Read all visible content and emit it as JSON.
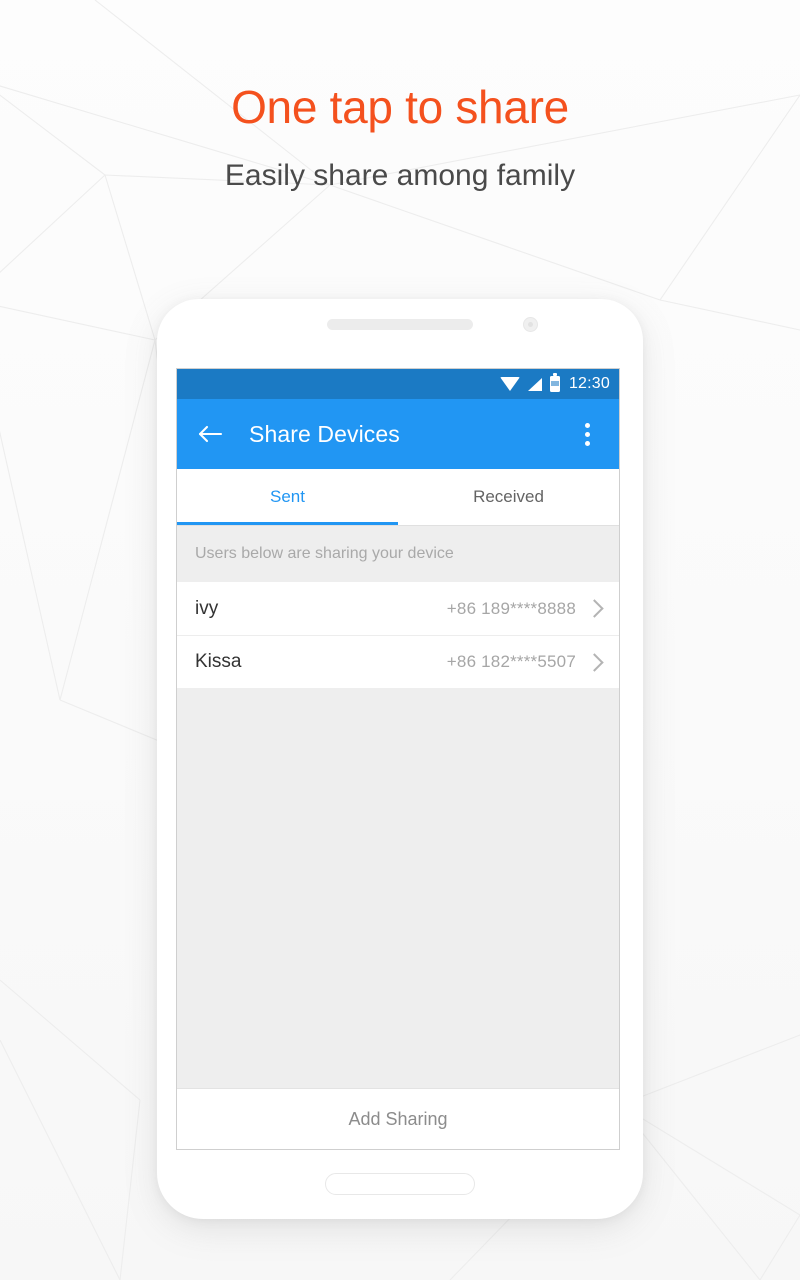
{
  "promo": {
    "headline": "One tap to share",
    "subheadline": "Easily share among family",
    "headline_color": "#f4511e",
    "subheadline_color": "#4a4a4a",
    "background_color": "#fbfbfb"
  },
  "device": {
    "frame_color": "#ffffff",
    "speaker_label": "earpiece-speaker",
    "camera_label": "front-camera",
    "home_button_label": "home-button"
  },
  "screen": {
    "status_bar": {
      "time": "12:30",
      "background_color": "#1b7ac4",
      "icons": [
        "wifi-icon",
        "signal-icon",
        "battery-icon"
      ]
    },
    "app_bar": {
      "title": "Share Devices",
      "background_color": "#2196f3",
      "back_label": "Back",
      "overflow_label": "More options"
    },
    "tabs": [
      {
        "label": "Sent",
        "active": true
      },
      {
        "label": "Received",
        "active": false
      }
    ],
    "tab_active_color": "#2196f3",
    "tab_inactive_color": "#646464",
    "section_header": "Users below are sharing your device",
    "list": [
      {
        "name": "ivy",
        "phone": "+86 189****8888"
      },
      {
        "name": "Kissa",
        "phone": "+86 182****5507"
      }
    ],
    "bottom_action": {
      "label": "Add Sharing"
    }
  }
}
